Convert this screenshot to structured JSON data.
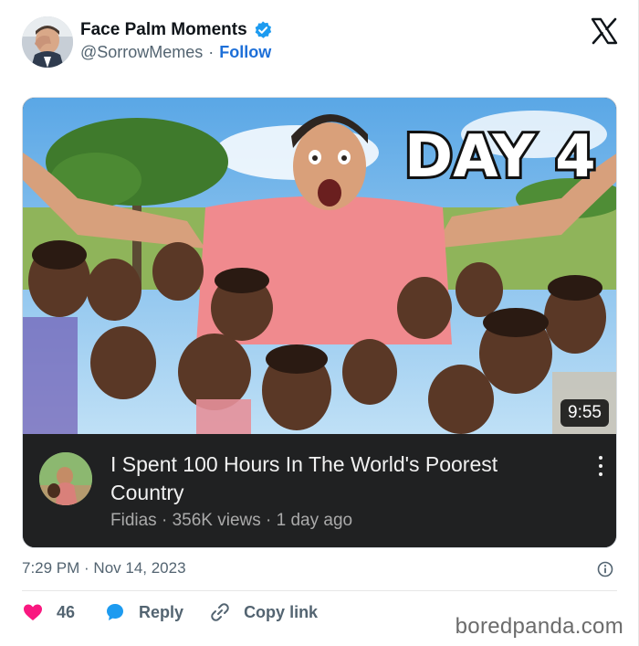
{
  "author": {
    "display_name": "Face Palm Moments",
    "handle": "@SorrowMemes",
    "separator": "·",
    "follow_label": "Follow",
    "verified": true
  },
  "platform_logo": "x-logo-icon",
  "video": {
    "thumbnail_caption": "DAY 4",
    "duration": "9:55",
    "title": "I Spent 100 Hours In The World's Poorest Country",
    "meta": "Fidias · 356K views · 1 day ago",
    "menu_icon": "kebab-menu-icon"
  },
  "post": {
    "timestamp": "7:29 PM · Nov 14, 2023",
    "info_icon": "info-icon"
  },
  "actions": {
    "like_count": "46",
    "reply_label": "Reply",
    "copy_label": "Copy link"
  },
  "watermark": "boredpanda.com",
  "colors": {
    "follow": "#1d6fd8",
    "like": "#f91880",
    "reply": "#1d9bf0",
    "verified": "#1d9bf0",
    "video_panel": "#202122"
  }
}
